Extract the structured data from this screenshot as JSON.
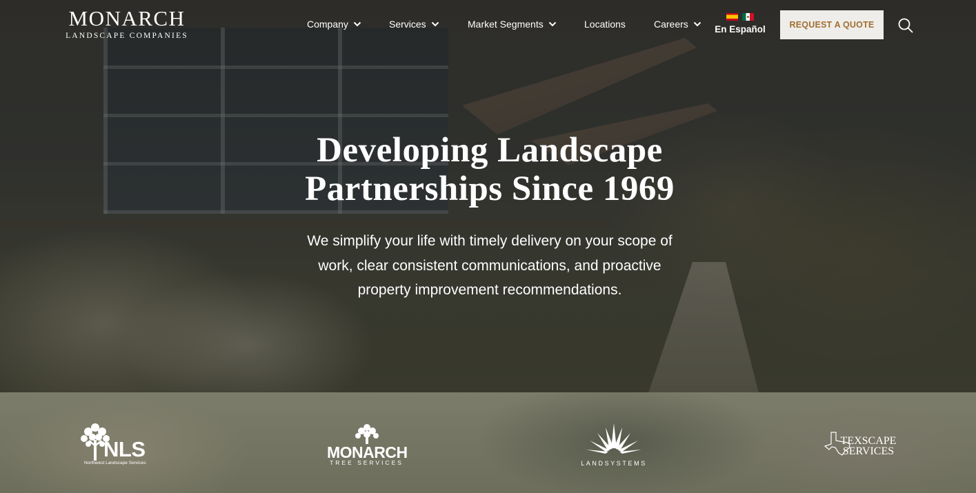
{
  "logo": {
    "main": "MONARCH",
    "sub": "LANDSCAPE COMPANIES"
  },
  "nav": {
    "items": [
      {
        "label": "Company",
        "has_dropdown": true
      },
      {
        "label": "Services",
        "has_dropdown": true
      },
      {
        "label": "Market Segments",
        "has_dropdown": true
      },
      {
        "label": "Locations",
        "has_dropdown": false
      },
      {
        "label": "Careers",
        "has_dropdown": true
      }
    ],
    "language_label": "En Español",
    "quote_button": "REQUEST A QUOTE",
    "search_icon": "search-icon"
  },
  "hero": {
    "title_line1": "Developing Landscape",
    "title_line2": "Partnerships Since 1969",
    "subtitle": "We simplify your life with timely delivery on your scope of work, clear consistent communications, and proactive property improvement recommendations."
  },
  "brands": [
    {
      "name": "NLS",
      "tagline": "Northwest Landscape Services"
    },
    {
      "name": "MONARCH",
      "tagline": "TREE SERVICES"
    },
    {
      "name": "",
      "tagline": "LANDSYSTEMS"
    },
    {
      "name": "TEXSCAPE SERVICES",
      "tagline": ""
    }
  ],
  "colors": {
    "accent": "#a06e32",
    "button_bg": "#efede9",
    "text": "#ffffff"
  }
}
